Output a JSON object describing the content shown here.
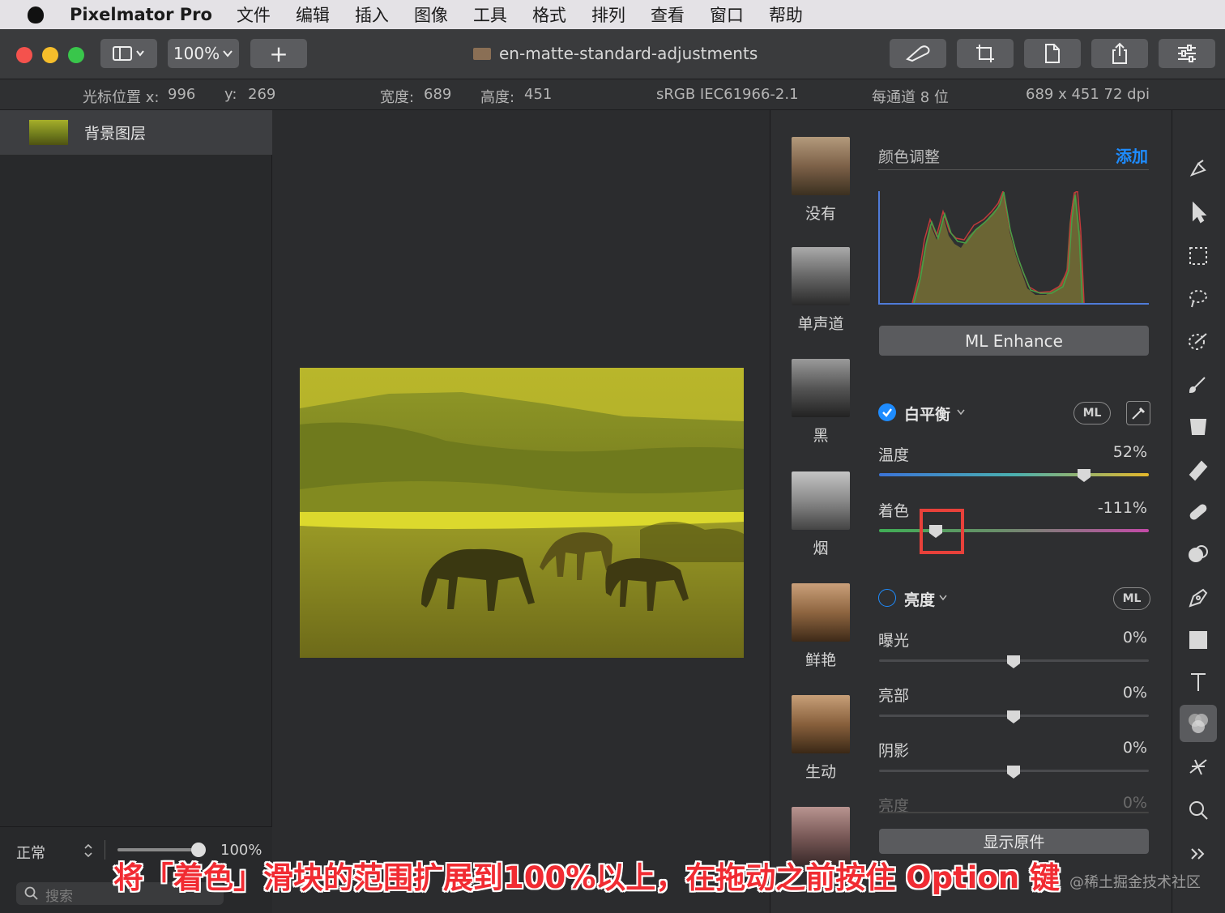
{
  "menubar": {
    "app_name": "Pixelmator Pro",
    "items": [
      "文件",
      "编辑",
      "插入",
      "图像",
      "工具",
      "格式",
      "排列",
      "查看",
      "窗口",
      "帮助"
    ]
  },
  "toolbar": {
    "zoom": "100%",
    "add_label": "+",
    "doc_title": "en-matte-standard-adjustments"
  },
  "infobar": {
    "cursor_x_label": "光标位置 x:",
    "cursor_x": "996",
    "cursor_y_label": "y:",
    "cursor_y": "269",
    "width_label": "宽度:",
    "width": "689",
    "height_label": "高度:",
    "height": "451",
    "color_profile": "sRGB IEC61966-2.1",
    "bit_depth": "每通道 8 位",
    "dims": "689 x 451 72 dpi"
  },
  "layers": {
    "items": [
      {
        "name": "背景图层"
      }
    ],
    "blend_mode": "正常",
    "opacity": "100%",
    "opacity_value": 1.0,
    "search_placeholder": "搜索"
  },
  "presets": [
    "没有",
    "单声道",
    "黑",
    "烟",
    "鲜艳",
    "生动"
  ],
  "adjust": {
    "header": "颜色调整",
    "add_link": "添加",
    "ml_enhance": "ML Enhance",
    "white_balance": {
      "title": "白平衡",
      "enabled": true,
      "ml": "ML",
      "temperature_label": "温度",
      "temperature_value": "52%",
      "temperature": 52,
      "tint_label": "着色",
      "tint_value": "-111%",
      "tint": -111
    },
    "lightness": {
      "title": "亮度",
      "enabled": false,
      "ml": "ML",
      "exposure_label": "曝光",
      "exposure_value": "0%",
      "highlights_label": "亮部",
      "highlights_value": "0%",
      "shadows_label": "阴影",
      "shadows_value": "0%",
      "more_label": "亮度",
      "more_value": "0%"
    },
    "show_original": "显示原件"
  },
  "tools": [
    "paint-bucket-icon",
    "arrow-icon",
    "selection-icon",
    "lasso-icon",
    "magic-wand-icon",
    "brush-icon",
    "fill-icon",
    "eraser-icon",
    "bandage-icon",
    "clone-icon",
    "pen-icon",
    "shape-icon",
    "text-icon",
    "color-adjust-icon",
    "effects-icon",
    "zoom-icon",
    "more-icon"
  ],
  "caption": "将「着色」滑块的范围扩展到100%以上，在拖动之前按住 Option 键",
  "watermark": "@稀土掘金技术社区",
  "colors": {
    "accent": "#1e8cff",
    "highlight": "#e8413a",
    "caption_text": "#f12b32"
  }
}
